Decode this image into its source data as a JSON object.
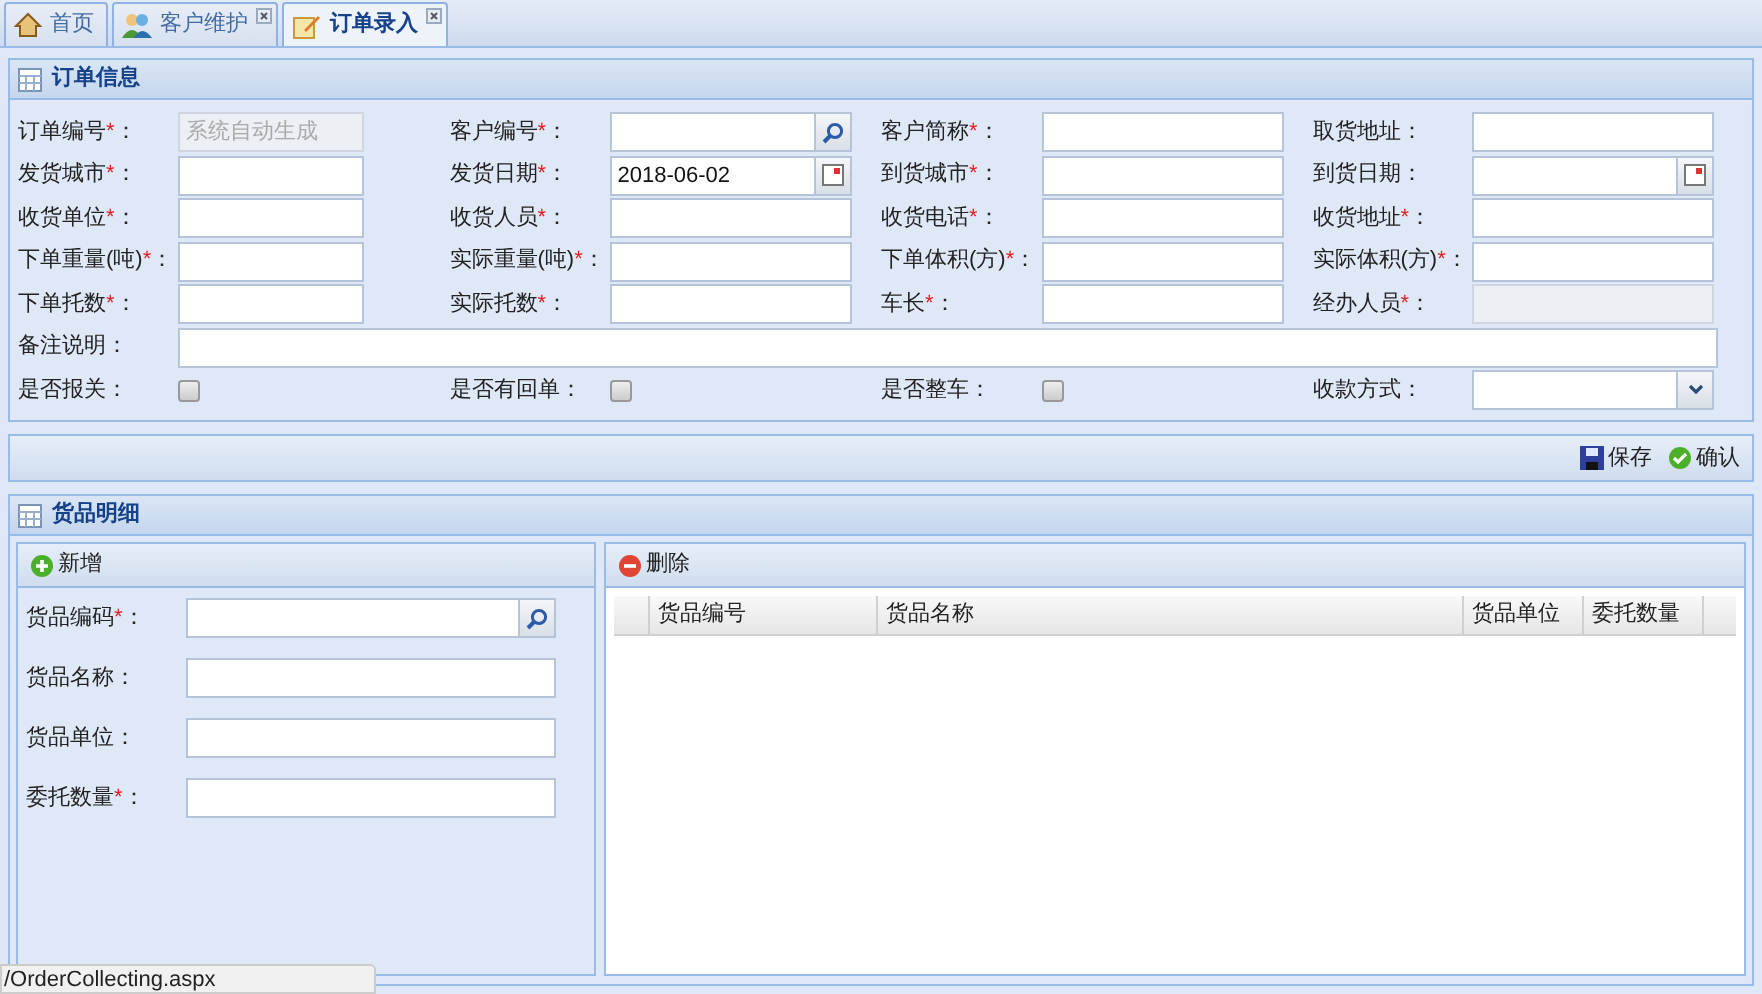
{
  "tabs": [
    {
      "label": "首页",
      "closable": false,
      "selected": false
    },
    {
      "label": "客户维护",
      "closable": true,
      "selected": false
    },
    {
      "label": "订单录入",
      "closable": true,
      "selected": true
    }
  ],
  "order_panel": {
    "title": "订单信息",
    "rows": [
      [
        {
          "label": "订单编号",
          "mark": "*",
          "colon": "：",
          "kind": "text",
          "disabled": true,
          "placeholder": "系统自动生成"
        },
        {
          "label": "客户编号",
          "mark": "*",
          "colon": "：",
          "kind": "search",
          "disabled": false
        },
        {
          "label": "客户简称",
          "mark": "*",
          "colon": "：",
          "kind": "text",
          "disabled": false
        },
        {
          "label": "取货地址",
          "colon": "：",
          "kind": "text",
          "disabled": false
        }
      ],
      [
        {
          "label": "发货城市",
          "mark": "*",
          "colon": "：",
          "kind": "text",
          "disabled": false
        },
        {
          "label": "发货日期",
          "mark": "*",
          "colon": "：",
          "kind": "date",
          "disabled": false,
          "value": "2018-06-02"
        },
        {
          "label": "到货城市",
          "mark": "*",
          "colon": "：",
          "kind": "text",
          "disabled": false
        },
        {
          "label": "到货日期",
          "colon": "：",
          "kind": "date",
          "disabled": false
        }
      ],
      [
        {
          "label": "收货单位",
          "mark": "*",
          "colon": "：",
          "kind": "text",
          "disabled": false
        },
        {
          "label": "收货人员",
          "mark": "*",
          "colon": "：",
          "kind": "text",
          "disabled": false
        },
        {
          "label": "收货电话",
          "mark": "*",
          "colon": "：",
          "kind": "text",
          "disabled": false
        },
        {
          "label": "收货地址",
          "mark": "*",
          "colon": "：",
          "kind": "text",
          "disabled": false
        }
      ],
      [
        {
          "label": "下单重量(吨)",
          "mark": "*",
          "colon": "：",
          "kind": "text",
          "disabled": false
        },
        {
          "label": "实际重量(吨)",
          "mark": "*",
          "colon": "：",
          "kind": "text",
          "disabled": false
        },
        {
          "label": "下单体积(方)",
          "mark": "*",
          "colon": "：",
          "kind": "text",
          "disabled": false
        },
        {
          "label": "实际体积(方)",
          "mark": "*",
          "colon": "：",
          "kind": "text",
          "disabled": false
        }
      ],
      [
        {
          "label": "下单托数",
          "mark": "*",
          "colon": "：",
          "kind": "text",
          "disabled": false
        },
        {
          "label": "实际托数",
          "mark": "*",
          "colon": "：",
          "kind": "text",
          "disabled": false
        },
        {
          "label": "车长",
          "mark": "*",
          "colon": "：",
          "kind": "text",
          "disabled": false
        },
        {
          "label": "经办人员",
          "mark": "*",
          "colon": "：",
          "kind": "text",
          "disabled": true
        }
      ],
      [
        {
          "label": "备注说明",
          "colon": "：",
          "kind": "wide",
          "disabled": false
        }
      ],
      [
        {
          "label": "是否报关",
          "colon": "：",
          "kind": "checkbox",
          "checked": false
        },
        {
          "label": "是否有回单",
          "colon": "：",
          "kind": "checkbox",
          "checked": false
        },
        {
          "label": "是否整车",
          "colon": "：",
          "kind": "checkbox",
          "checked": false
        },
        {
          "label": "收款方式",
          "colon": "：",
          "kind": "select",
          "disabled": false
        }
      ]
    ]
  },
  "toolbar": [
    {
      "label": "保存"
    },
    {
      "label": "确认"
    }
  ],
  "goods_panel": {
    "title": "货品明细",
    "form": {
      "button": {
        "label": "新增"
      },
      "fields": [
        {
          "label": "货品编码",
          "mark": "*",
          "colon": "：",
          "kind": "search"
        },
        {
          "label": "货品名称",
          "colon": "：",
          "kind": "text"
        },
        {
          "label": "货品单位",
          "colon": "：",
          "kind": "text"
        },
        {
          "label": "委托数量",
          "mark": "*",
          "colon": "：",
          "kind": "text"
        }
      ]
    },
    "grid": {
      "button": {
        "label": "删除"
      },
      "columns": [
        "货品编号",
        "货品名称",
        "货品单位",
        "委托数量"
      ]
    }
  },
  "status_tooltip": "/OrderCollecting.aspx"
}
